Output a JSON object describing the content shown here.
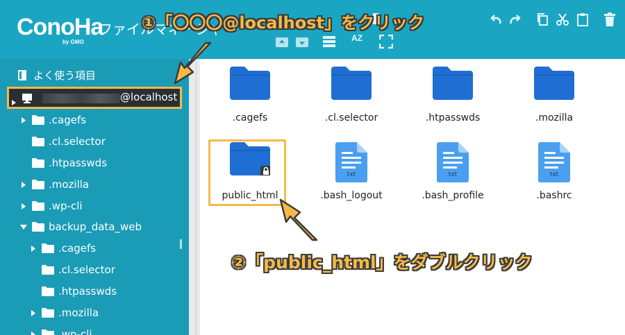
{
  "header": {
    "logo": "ConoHa",
    "logo_sub": "by GMO",
    "title": "ファイルマネージャー"
  },
  "toolbar": {
    "icons": [
      "upload-icon",
      "download-icon",
      "list-view-icon",
      "sort-az-icon",
      "fullscreen-icon",
      "file-icon",
      "undo-icon",
      "redo-icon",
      "copy-icon",
      "cut-icon",
      "paste-icon",
      "trash-icon"
    ],
    "sort_label": "AZ"
  },
  "sidebar": {
    "favorites": "よく使う項目",
    "host": "@localhost",
    "tree": [
      {
        "label": ".cagefs",
        "caret": true
      },
      {
        "label": ".cl.selector",
        "caret": false
      },
      {
        "label": ".htpasswds",
        "caret": false
      },
      {
        "label": ".mozilla",
        "caret": true
      },
      {
        "label": ".wp-cli",
        "caret": true
      },
      {
        "label": "backup_data_web",
        "caret": "open"
      },
      {
        "label": ".cagefs",
        "caret": true
      },
      {
        "label": ".cl.selector",
        "caret": false
      },
      {
        "label": ".htpasswds",
        "caret": false
      },
      {
        "label": ".mozilla",
        "caret": true
      },
      {
        "label": ".wp-cli",
        "caret": true
      }
    ]
  },
  "files": [
    {
      "name": ".cagefs",
      "type": "folder"
    },
    {
      "name": ".cl.selector",
      "type": "folder"
    },
    {
      "name": ".htpasswds",
      "type": "folder"
    },
    {
      "name": ".mozilla",
      "type": "folder"
    },
    {
      "name": "public_html",
      "type": "folder-locked"
    },
    {
      "name": ".bash_logout",
      "type": "txt"
    },
    {
      "name": ".bash_profile",
      "type": "txt"
    },
    {
      "name": ".bashrc",
      "type": "txt"
    }
  ],
  "file_badge": "txt",
  "annotations": {
    "step1": "①「〇〇〇@localhost」をクリック",
    "step2": "②「public_html」をダブルクリック"
  },
  "colors": {
    "header": "#1aa6c3",
    "sidebar": "#1a9bb6",
    "folder": "#1f6ed4",
    "txt": "#4a9ff0",
    "highlight": "#f5b948"
  }
}
